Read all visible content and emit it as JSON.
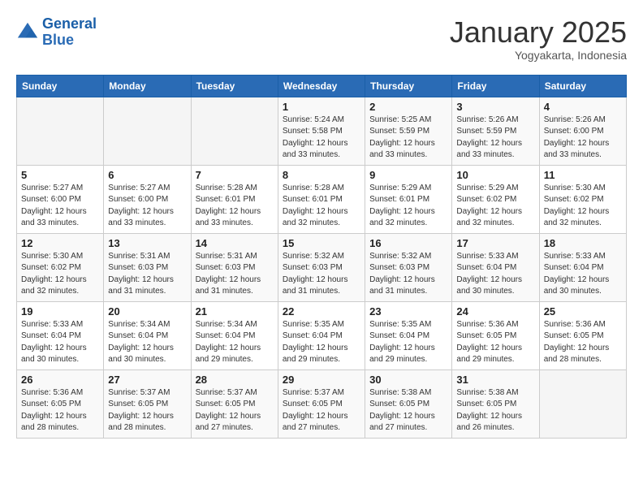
{
  "header": {
    "logo_line1": "General",
    "logo_line2": "Blue",
    "title": "January 2025",
    "subtitle": "Yogyakarta, Indonesia"
  },
  "weekdays": [
    "Sunday",
    "Monday",
    "Tuesday",
    "Wednesday",
    "Thursday",
    "Friday",
    "Saturday"
  ],
  "weeks": [
    [
      {
        "day": "",
        "info": ""
      },
      {
        "day": "",
        "info": ""
      },
      {
        "day": "",
        "info": ""
      },
      {
        "day": "1",
        "info": "Sunrise: 5:24 AM\nSunset: 5:58 PM\nDaylight: 12 hours\nand 33 minutes."
      },
      {
        "day": "2",
        "info": "Sunrise: 5:25 AM\nSunset: 5:59 PM\nDaylight: 12 hours\nand 33 minutes."
      },
      {
        "day": "3",
        "info": "Sunrise: 5:26 AM\nSunset: 5:59 PM\nDaylight: 12 hours\nand 33 minutes."
      },
      {
        "day": "4",
        "info": "Sunrise: 5:26 AM\nSunset: 6:00 PM\nDaylight: 12 hours\nand 33 minutes."
      }
    ],
    [
      {
        "day": "5",
        "info": "Sunrise: 5:27 AM\nSunset: 6:00 PM\nDaylight: 12 hours\nand 33 minutes."
      },
      {
        "day": "6",
        "info": "Sunrise: 5:27 AM\nSunset: 6:00 PM\nDaylight: 12 hours\nand 33 minutes."
      },
      {
        "day": "7",
        "info": "Sunrise: 5:28 AM\nSunset: 6:01 PM\nDaylight: 12 hours\nand 33 minutes."
      },
      {
        "day": "8",
        "info": "Sunrise: 5:28 AM\nSunset: 6:01 PM\nDaylight: 12 hours\nand 32 minutes."
      },
      {
        "day": "9",
        "info": "Sunrise: 5:29 AM\nSunset: 6:01 PM\nDaylight: 12 hours\nand 32 minutes."
      },
      {
        "day": "10",
        "info": "Sunrise: 5:29 AM\nSunset: 6:02 PM\nDaylight: 12 hours\nand 32 minutes."
      },
      {
        "day": "11",
        "info": "Sunrise: 5:30 AM\nSunset: 6:02 PM\nDaylight: 12 hours\nand 32 minutes."
      }
    ],
    [
      {
        "day": "12",
        "info": "Sunrise: 5:30 AM\nSunset: 6:02 PM\nDaylight: 12 hours\nand 32 minutes."
      },
      {
        "day": "13",
        "info": "Sunrise: 5:31 AM\nSunset: 6:03 PM\nDaylight: 12 hours\nand 31 minutes."
      },
      {
        "day": "14",
        "info": "Sunrise: 5:31 AM\nSunset: 6:03 PM\nDaylight: 12 hours\nand 31 minutes."
      },
      {
        "day": "15",
        "info": "Sunrise: 5:32 AM\nSunset: 6:03 PM\nDaylight: 12 hours\nand 31 minutes."
      },
      {
        "day": "16",
        "info": "Sunrise: 5:32 AM\nSunset: 6:03 PM\nDaylight: 12 hours\nand 31 minutes."
      },
      {
        "day": "17",
        "info": "Sunrise: 5:33 AM\nSunset: 6:04 PM\nDaylight: 12 hours\nand 30 minutes."
      },
      {
        "day": "18",
        "info": "Sunrise: 5:33 AM\nSunset: 6:04 PM\nDaylight: 12 hours\nand 30 minutes."
      }
    ],
    [
      {
        "day": "19",
        "info": "Sunrise: 5:33 AM\nSunset: 6:04 PM\nDaylight: 12 hours\nand 30 minutes."
      },
      {
        "day": "20",
        "info": "Sunrise: 5:34 AM\nSunset: 6:04 PM\nDaylight: 12 hours\nand 30 minutes."
      },
      {
        "day": "21",
        "info": "Sunrise: 5:34 AM\nSunset: 6:04 PM\nDaylight: 12 hours\nand 29 minutes."
      },
      {
        "day": "22",
        "info": "Sunrise: 5:35 AM\nSunset: 6:04 PM\nDaylight: 12 hours\nand 29 minutes."
      },
      {
        "day": "23",
        "info": "Sunrise: 5:35 AM\nSunset: 6:04 PM\nDaylight: 12 hours\nand 29 minutes."
      },
      {
        "day": "24",
        "info": "Sunrise: 5:36 AM\nSunset: 6:05 PM\nDaylight: 12 hours\nand 29 minutes."
      },
      {
        "day": "25",
        "info": "Sunrise: 5:36 AM\nSunset: 6:05 PM\nDaylight: 12 hours\nand 28 minutes."
      }
    ],
    [
      {
        "day": "26",
        "info": "Sunrise: 5:36 AM\nSunset: 6:05 PM\nDaylight: 12 hours\nand 28 minutes."
      },
      {
        "day": "27",
        "info": "Sunrise: 5:37 AM\nSunset: 6:05 PM\nDaylight: 12 hours\nand 28 minutes."
      },
      {
        "day": "28",
        "info": "Sunrise: 5:37 AM\nSunset: 6:05 PM\nDaylight: 12 hours\nand 27 minutes."
      },
      {
        "day": "29",
        "info": "Sunrise: 5:37 AM\nSunset: 6:05 PM\nDaylight: 12 hours\nand 27 minutes."
      },
      {
        "day": "30",
        "info": "Sunrise: 5:38 AM\nSunset: 6:05 PM\nDaylight: 12 hours\nand 27 minutes."
      },
      {
        "day": "31",
        "info": "Sunrise: 5:38 AM\nSunset: 6:05 PM\nDaylight: 12 hours\nand 26 minutes."
      },
      {
        "day": "",
        "info": ""
      }
    ]
  ]
}
